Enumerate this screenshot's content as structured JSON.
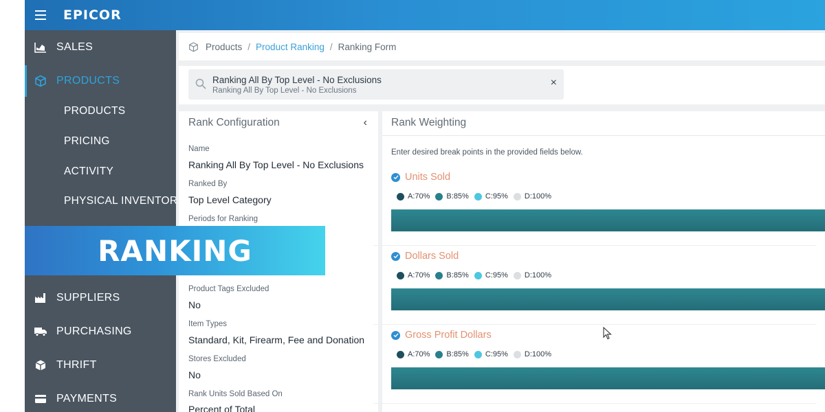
{
  "app": {
    "logo": "EPICOR"
  },
  "sidebar": {
    "items": [
      {
        "label": "SALES",
        "icon": "chart-icon",
        "active": false
      },
      {
        "label": "PRODUCTS",
        "icon": "cube-icon",
        "active": true
      },
      {
        "label": "PRODUCTS",
        "icon": "",
        "active": false
      },
      {
        "label": "PRICING",
        "icon": "",
        "active": false
      },
      {
        "label": "ACTIVITY",
        "icon": "",
        "active": false
      },
      {
        "label": "PHYSICAL INVENTORY",
        "icon": "",
        "active": false
      },
      {
        "label": "SUPPLIERS",
        "icon": "factory-icon",
        "active": false
      },
      {
        "label": "PURCHASING",
        "icon": "truck-icon",
        "active": false
      },
      {
        "label": "THRIFT",
        "icon": "box-icon",
        "active": false
      },
      {
        "label": "PAYMENTS",
        "icon": "card-icon",
        "active": false
      }
    ],
    "active_color": "#2fa3dc"
  },
  "breadcrumb": {
    "items": [
      "Products",
      "Product Ranking",
      "Ranking Form"
    ],
    "separator": "/"
  },
  "search": {
    "title": "Ranking All By Top Level - No Exclusions",
    "subtitle": "Ranking All By Top Level - No Exclusions",
    "close_glyph": "×"
  },
  "config": {
    "title": "Rank Configuration",
    "collapse_glyph": "‹",
    "fields": [
      {
        "label": "Name",
        "value": "Ranking All By Top Level - No Exclusions"
      },
      {
        "label": "Ranked By",
        "value": "Top Level Category"
      },
      {
        "label": "Periods for Ranking",
        "value": ""
      },
      {
        "label": "Product Tags Excluded",
        "value": "No"
      },
      {
        "label": "Item Types",
        "value": "Standard, Kit, Firearm, Fee and Donation"
      },
      {
        "label": "Stores Excluded",
        "value": "No"
      },
      {
        "label": "Rank Units Sold Based On",
        "value": "Percent of Total"
      }
    ]
  },
  "weighting": {
    "title": "Rank Weighting",
    "hint": "Enter desired break points in the provided fields below.",
    "metrics": [
      {
        "title": "Units Sold"
      },
      {
        "title": "Dollars Sold"
      },
      {
        "title": "Gross Profit Dollars"
      }
    ],
    "legend": [
      {
        "label": "A:70%",
        "color": "#1f4f5c"
      },
      {
        "label": "B:85%",
        "color": "#2a7f8c"
      },
      {
        "label": "C:95%",
        "color": "#4fc6e2"
      },
      {
        "label": "D:100%",
        "color": "#dcdfe2"
      }
    ],
    "metric_title_color": "#e49070"
  },
  "overlay": {
    "text": "RANKING"
  }
}
